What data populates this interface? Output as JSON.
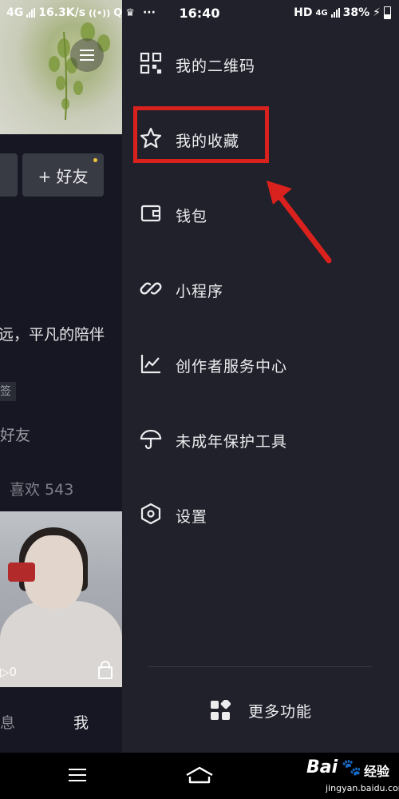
{
  "status_bar": {
    "network": "4G",
    "speed": "16.3K/s",
    "time": "16:40",
    "hd": "HD",
    "network_right": "4G",
    "battery": "38%"
  },
  "profile": {
    "add_friend": "+ 好友",
    "bio": "远，平凡的陪伴",
    "tag": "签",
    "friends": "好友",
    "likes": "喜欢 543",
    "video_play_count": "0",
    "tab_messages": "息",
    "tab_me": "我"
  },
  "drawer": {
    "items": [
      {
        "label": "我的二维码",
        "icon": "qr-code-icon"
      },
      {
        "label": "我的收藏",
        "icon": "star-icon"
      },
      {
        "label": "钱包",
        "icon": "wallet-icon"
      },
      {
        "label": "小程序",
        "icon": "link-icon"
      },
      {
        "label": "创作者服务中心",
        "icon": "chart-icon"
      },
      {
        "label": "未成年保护工具",
        "icon": "umbrella-icon"
      },
      {
        "label": "设置",
        "icon": "hexagon-settings-icon"
      }
    ],
    "more_label": "更多功能"
  },
  "annotation": {
    "highlight_color": "#d9211d"
  },
  "watermark": {
    "brand": "Bai",
    "brand_cn": "经验",
    "url": "jingyan.baidu.com"
  }
}
